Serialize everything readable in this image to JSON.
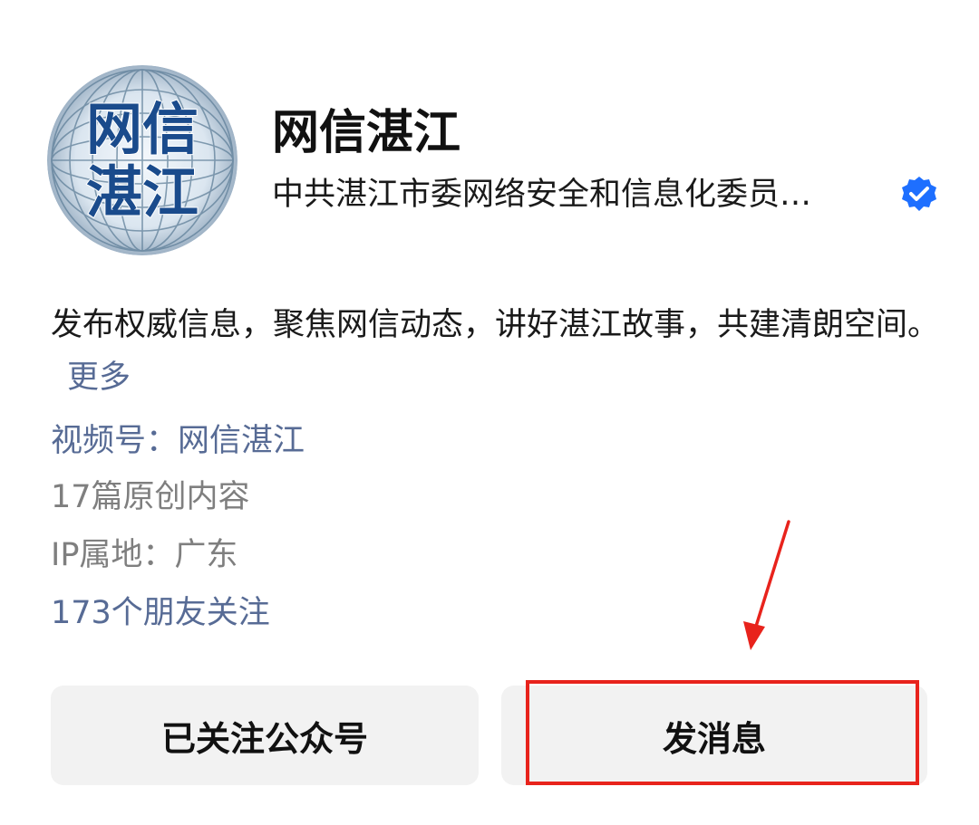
{
  "profile": {
    "avatar_text_line1": "网信",
    "avatar_text_line2": "湛江",
    "name": "网信湛江",
    "organization": "中共湛江市委网络安全和信息化委员…",
    "verified_icon": "verified-badge-icon"
  },
  "description": {
    "text": "发布权威信息，聚焦网信动态，讲好湛江故事，共建清朗空间。",
    "more_label": "更多"
  },
  "meta": {
    "channel": "视频号：网信湛江",
    "original_count": "17篇原创内容",
    "ip_location": "IP属地：广东",
    "friends_following": "173个朋友关注"
  },
  "actions": {
    "follow_label": "已关注公众号",
    "message_label": "发消息"
  },
  "colors": {
    "link": "#576b95",
    "highlight": "#e8231c",
    "verified": "#1e6fff",
    "button_bg": "#f2f2f2"
  }
}
